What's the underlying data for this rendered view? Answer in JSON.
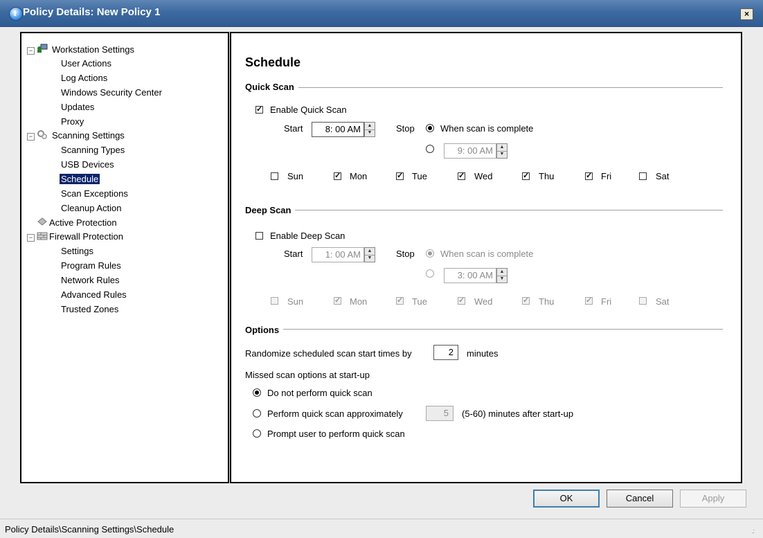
{
  "window": {
    "title": "Policy Details: New Policy 1",
    "close_glyph": "×"
  },
  "tree": {
    "nodes": [
      {
        "label": "Workstation Settings",
        "icon": "workstation-icon",
        "expander": "−"
      },
      {
        "label": "User Actions"
      },
      {
        "label": "Log Actions"
      },
      {
        "label": "Windows Security Center"
      },
      {
        "label": "Updates"
      },
      {
        "label": "Proxy"
      },
      {
        "label": "Scanning Settings",
        "icon": "scanning-icon",
        "expander": "−"
      },
      {
        "label": "Scanning Types"
      },
      {
        "label": "USB Devices"
      },
      {
        "label": "Schedule",
        "selected": true
      },
      {
        "label": "Scan Exceptions"
      },
      {
        "label": "Cleanup Action"
      },
      {
        "label": "Active Protection",
        "icon": "shield-icon"
      },
      {
        "label": "Firewall Protection",
        "icon": "firewall-icon",
        "expander": "−"
      },
      {
        "label": "Settings"
      },
      {
        "label": "Program Rules"
      },
      {
        "label": "Network Rules"
      },
      {
        "label": "Advanced Rules"
      },
      {
        "label": "Trusted Zones"
      }
    ]
  },
  "page": {
    "heading": "Schedule"
  },
  "quick_scan": {
    "group_label": "Quick Scan",
    "enable_label": "Enable Quick Scan",
    "enabled": true,
    "start_label": "Start",
    "start_time": "8: 00 AM",
    "stop_label": "Stop",
    "stop_option_complete": "When scan is complete",
    "stop_time": "9: 00 AM",
    "days": [
      {
        "label": "Sun",
        "checked": false
      },
      {
        "label": "Mon",
        "checked": true
      },
      {
        "label": "Tue",
        "checked": true
      },
      {
        "label": "Wed",
        "checked": true
      },
      {
        "label": "Thu",
        "checked": true
      },
      {
        "label": "Fri",
        "checked": true
      },
      {
        "label": "Sat",
        "checked": false
      }
    ]
  },
  "deep_scan": {
    "group_label": "Deep Scan",
    "enable_label": "Enable Deep Scan",
    "enabled": false,
    "start_label": "Start",
    "start_time": "1: 00 AM",
    "stop_label": "Stop",
    "stop_option_complete": "When scan is complete",
    "stop_time": "3: 00 AM",
    "days": [
      {
        "label": "Sun",
        "checked": false
      },
      {
        "label": "Mon",
        "checked": true
      },
      {
        "label": "Tue",
        "checked": true
      },
      {
        "label": "Wed",
        "checked": true
      },
      {
        "label": "Thu",
        "checked": true
      },
      {
        "label": "Fri",
        "checked": true
      },
      {
        "label": "Sat",
        "checked": false
      }
    ]
  },
  "options": {
    "group_label": "Options",
    "randomize_prefix": "Randomize scheduled scan start times by",
    "randomize_value": "2",
    "randomize_suffix": "minutes",
    "missed_label": "Missed scan options at start-up",
    "opt_no_scan": "Do not perform quick scan",
    "opt_perform": "Perform quick scan approximately",
    "perform_minutes": "5",
    "perform_suffix": "(5-60) minutes after start-up",
    "opt_prompt": "Prompt user to perform quick scan",
    "selected_option": "no_scan"
  },
  "buttons": {
    "ok": "OK",
    "cancel": "Cancel",
    "apply": "Apply"
  },
  "status": {
    "path": "Policy Details\\Scanning Settings\\Schedule",
    "grip_glyph": ".:"
  }
}
